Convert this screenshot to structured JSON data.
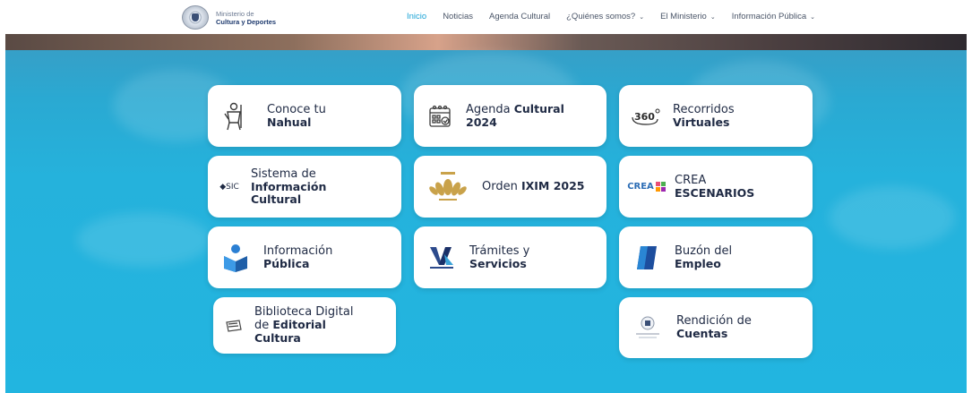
{
  "header": {
    "logo_line1": "Ministerio de",
    "logo_line2": "Cultura y Deportes",
    "nav": [
      {
        "label": "Inicio",
        "active": true,
        "dropdown": false
      },
      {
        "label": "Noticias",
        "active": false,
        "dropdown": false
      },
      {
        "label": "Agenda Cultural",
        "active": false,
        "dropdown": false
      },
      {
        "label": "¿Quiénes somos?",
        "active": false,
        "dropdown": true
      },
      {
        "label": "El Ministerio",
        "active": false,
        "dropdown": true
      },
      {
        "label": "Información Pública",
        "active": false,
        "dropdown": true
      }
    ]
  },
  "cards": {
    "nahual": {
      "line1": "Conoce tu",
      "line2": "Nahual",
      "icon": "nahual-figure-icon"
    },
    "agenda": {
      "line1a": "Agenda ",
      "line1b": "Cultural",
      "line2": "2024",
      "icon": "calendar-icon"
    },
    "recorridos": {
      "line1": "Recorridos",
      "line2": "Virtuales",
      "icon": "360-icon"
    },
    "sic": {
      "line1": "Sistema de",
      "line2": "Información",
      "line3": "Cultural",
      "icon_text": "SIC"
    },
    "ixim": {
      "line1a": "Orden ",
      "line1b": "IXIM 2025",
      "icon": "ixim-emblem-icon"
    },
    "crea": {
      "line1": "CREA",
      "line2": "ESCENARIOS",
      "icon_text": "CREA"
    },
    "info_publica": {
      "line1": "Información",
      "line2": "Pública",
      "icon": "person-book-icon"
    },
    "tramites": {
      "line1": "Trámites y",
      "line2": "Servicios",
      "icon": "ventanilla-icon"
    },
    "empleo": {
      "line1": "Buzón del",
      "line2": "Empleo",
      "icon": "employment-icon"
    },
    "biblioteca": {
      "line1": "Biblioteca Digital",
      "line2a": "de ",
      "line2b": "Editorial",
      "line3": "Cultura",
      "icon": "book-icon"
    },
    "rendicion": {
      "line1": "Rendición de",
      "line2": "Cuentas",
      "icon": "seal-icon"
    }
  },
  "colors": {
    "accent": "#1ba3d6",
    "hero": "#22b5e0",
    "text": "#1f2a44"
  }
}
